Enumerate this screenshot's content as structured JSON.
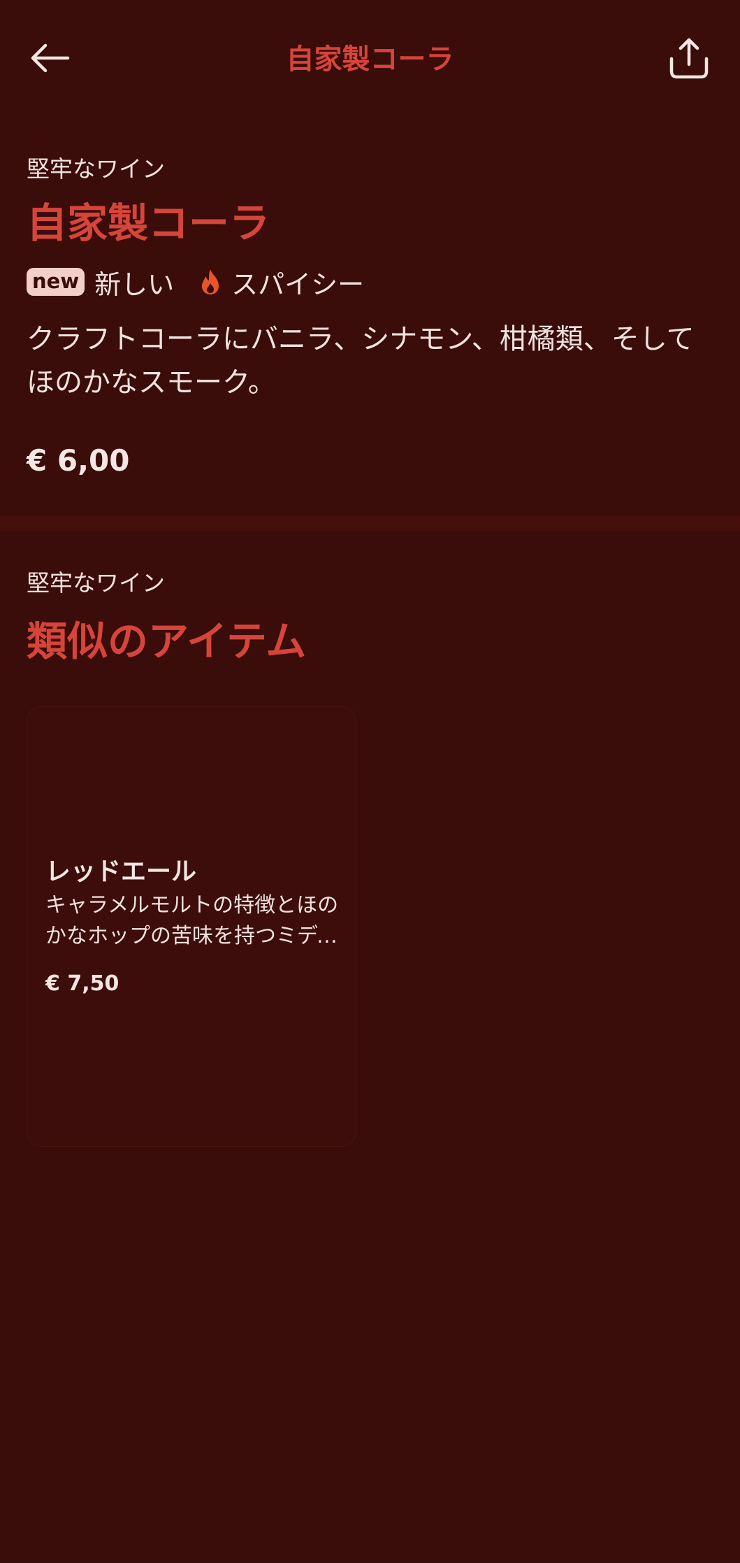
{
  "header": {
    "title": "自家製コーラ",
    "back_icon": "arrow-left-icon",
    "share_icon": "share-icon"
  },
  "product": {
    "category": "堅牢なワイン",
    "title": "自家製コーラ",
    "badge": "new",
    "tag_new": "新しい",
    "tag_spicy": "スパイシー",
    "spicy_icon": "fire-icon",
    "description": "クラフトコーラにバニラ、シナモン、柑橘類、そしてほのかなスモーク。",
    "price": "€ 6,00"
  },
  "similar": {
    "category": "堅牢なワイン",
    "title": "類似のアイテム",
    "items": [
      {
        "title": "レッドエール",
        "description": "キャラメルモルトの特徴とほのかなホップの苦味を持つミディアムボディのエール。",
        "price": "€ 7,50"
      }
    ]
  },
  "colors": {
    "background": "#3a0c0a",
    "accent": "#d6453a",
    "text": "#f3e6e3",
    "badge_bg": "#f2cfc9",
    "fire": "#e8552b"
  }
}
